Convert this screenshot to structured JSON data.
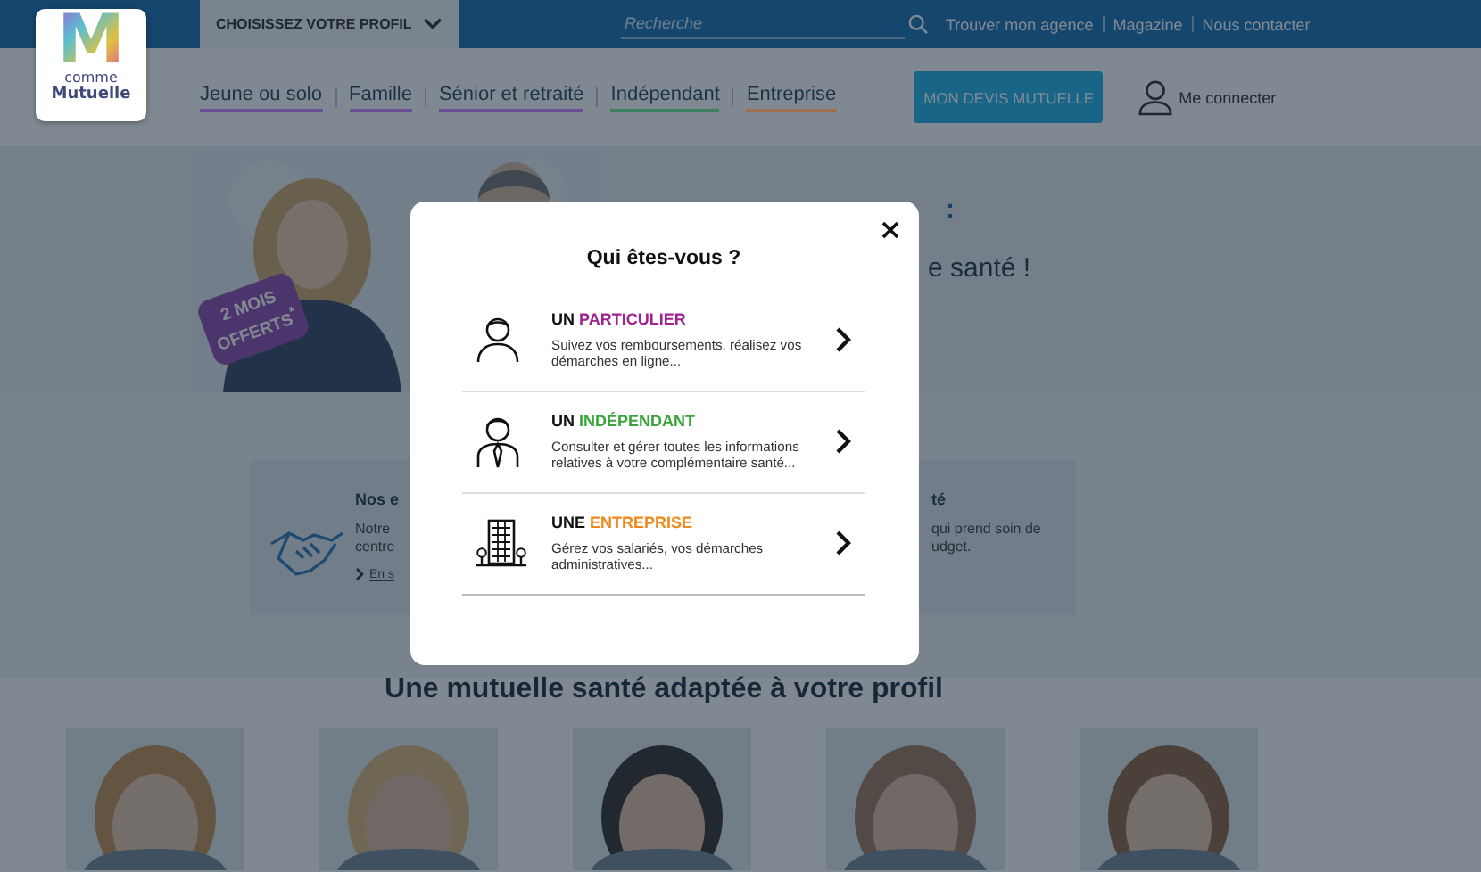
{
  "top_bar": {
    "profile_selector": "CHOISISSEZ VOTRE PROFIL",
    "search": {
      "placeholder": "Recherche"
    },
    "links": [
      "Trouver mon agence",
      "Magazine",
      "Nous contacter"
    ]
  },
  "logo": {
    "letter": "M",
    "line1": "comme",
    "line2": "Mutuelle"
  },
  "nav": [
    {
      "label": "Jeune ou solo",
      "color": "#6a4f92"
    },
    {
      "label": "Famille",
      "color": "#6a4f92"
    },
    {
      "label": "Sénior et retraité",
      "color": "#6a4f92"
    },
    {
      "label": "Indépendant",
      "color": "#3d8060"
    },
    {
      "label": "Entreprise",
      "color": "#9a7050"
    }
  ],
  "cta": "MON DEVIS MUTUELLE",
  "login": "Me connecter",
  "hero": {
    "badge": "2 MOIS OFFERTS$^{*}$",
    "title": ":",
    "subtitle": "e santé !"
  },
  "features": [
    {
      "title": "Nos e",
      "lines": [
        "Notre",
        "centre"
      ],
      "link": "En s"
    },
    {
      "title": "té",
      "lines": [
        "qui prend soin de",
        "udget."
      ]
    }
  ],
  "section_title": "Une mutuelle santé adaptée à votre profil",
  "modal": {
    "title": "Qui êtes-vous ?",
    "items": [
      {
        "kind": "person",
        "prefix": "UN",
        "highlight": "PARTICULIER",
        "color": "#a0238f",
        "description": "Suivez vos remboursements, réalisez vos démarches en ligne..."
      },
      {
        "kind": "worker",
        "prefix": "UN",
        "highlight": "INDÉPENDANT",
        "color": "#3aa53a",
        "description": "Consulter et gérer toutes les informations relatives à votre complémentaire santé..."
      },
      {
        "kind": "building",
        "prefix": "UNE",
        "highlight": "ENTREPRISE",
        "color": "#ee8a1c",
        "description": "Gérez vos salariés, vos démarches administratives..."
      }
    ]
  }
}
